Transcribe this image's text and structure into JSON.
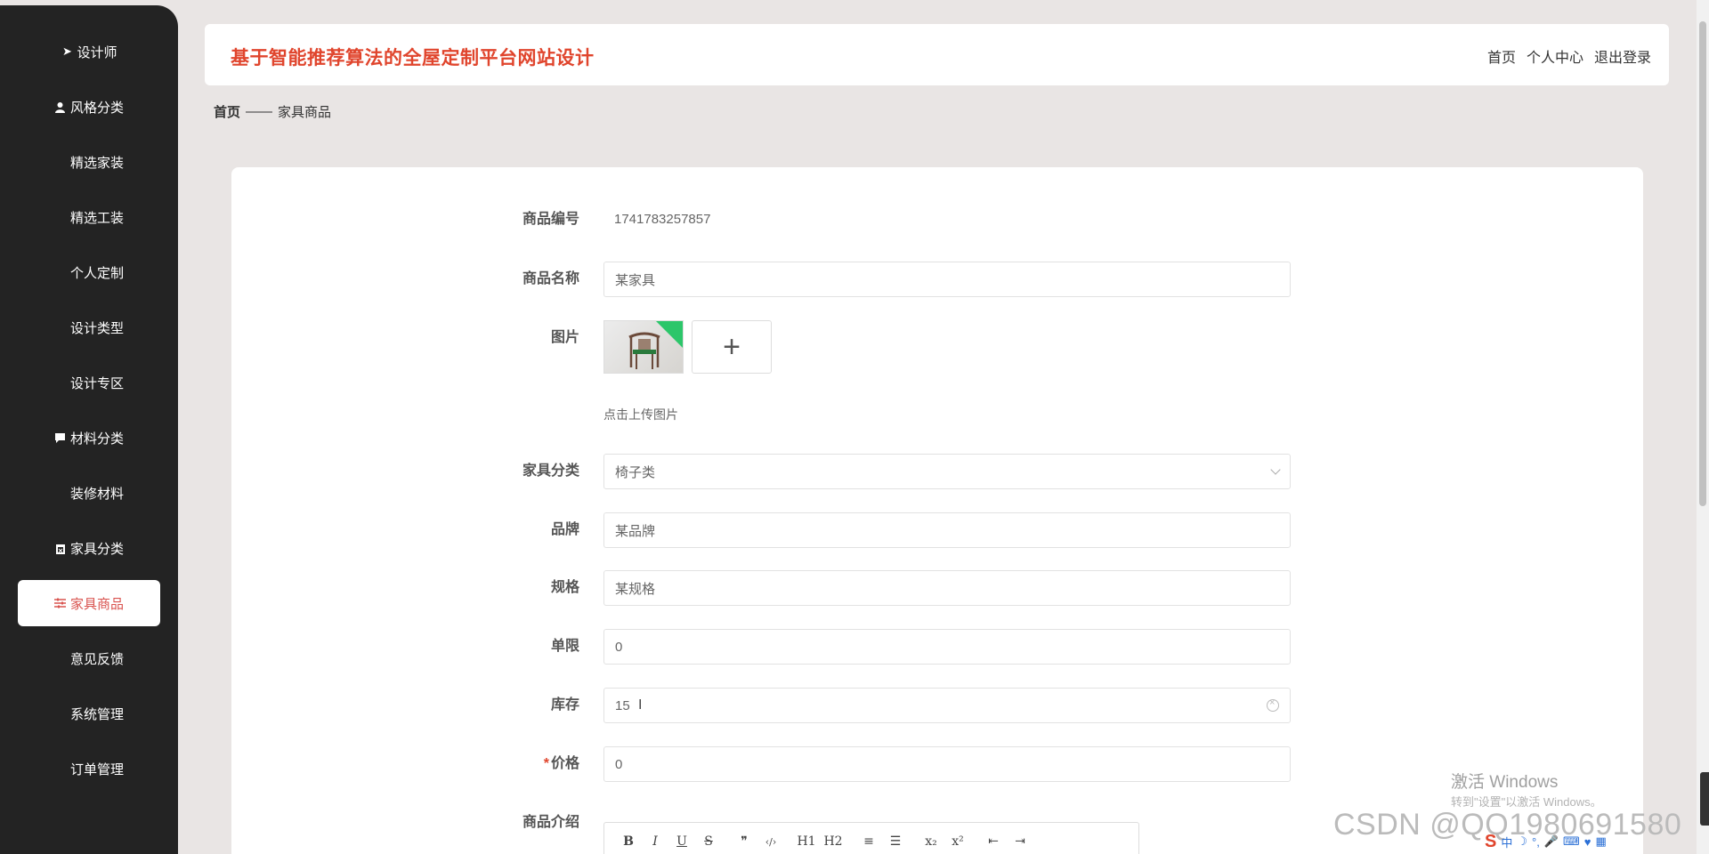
{
  "site": {
    "title": "基于智能推荐算法的全屋定制平台网站设计",
    "nav": {
      "home": "首页",
      "profile": "个人中心",
      "logout": "退出登录"
    }
  },
  "sidebar": {
    "items": [
      {
        "label": "设计师",
        "icon": "send-icon",
        "active": false
      },
      {
        "label": "风格分类",
        "icon": "user-icon",
        "active": false
      },
      {
        "label": "精选家装",
        "icon": "grid-icon",
        "active": false
      },
      {
        "label": "精选工装",
        "icon": "grid-icon",
        "active": false
      },
      {
        "label": "个人定制",
        "icon": "grid-icon",
        "active": false
      },
      {
        "label": "设计类型",
        "icon": "grid-icon",
        "active": false
      },
      {
        "label": "设计专区",
        "icon": "grid-icon",
        "active": false
      },
      {
        "label": "材料分类",
        "icon": "comment-icon",
        "active": false
      },
      {
        "label": "装修材料",
        "icon": "grid-icon",
        "active": false
      },
      {
        "label": "家具分类",
        "icon": "trash-icon",
        "active": false
      },
      {
        "label": "家具商品",
        "icon": "sliders-icon",
        "active": true
      },
      {
        "label": "意见反馈",
        "icon": "grid-icon",
        "active": false
      },
      {
        "label": "系统管理",
        "icon": "grid-icon",
        "active": false
      },
      {
        "label": "订单管理",
        "icon": "list-icon",
        "active": false
      }
    ]
  },
  "breadcrumb": {
    "home": "首页",
    "separator": "——",
    "current": "家具商品"
  },
  "form": {
    "code": {
      "label": "商品编号",
      "value": "1741783257857"
    },
    "name": {
      "label": "商品名称",
      "value": "某家具"
    },
    "image": {
      "label": "图片",
      "upload_tip": "点击上传图片",
      "add_symbol": "+"
    },
    "category": {
      "label": "家具分类",
      "value": "椅子类"
    },
    "brand": {
      "label": "品牌",
      "value": "某品牌"
    },
    "spec": {
      "label": "规格",
      "value": "某规格"
    },
    "limit": {
      "label": "单限",
      "value": "0"
    },
    "stock": {
      "label": "库存",
      "value": "15"
    },
    "price": {
      "label": "价格",
      "required_mark": "*",
      "value": "0"
    },
    "intro": {
      "label": "商品介绍",
      "toolbar": [
        "B",
        "I",
        "U",
        "S",
        "❞",
        "‹/›",
        "H1",
        "H2",
        "≡",
        "☰",
        "x₂",
        "x²",
        "⇤",
        "⇥"
      ]
    }
  },
  "overlay": {
    "windows_activate": "激活 Windows",
    "windows_activate_sub": "转到\"设置\"以激活 Windows。",
    "csdn_watermark": "CSDN @QQ1980691580"
  },
  "colors": {
    "accent": "#e0452d",
    "sidebar_bg": "#232323",
    "page_bg": "#e9e5e4"
  }
}
